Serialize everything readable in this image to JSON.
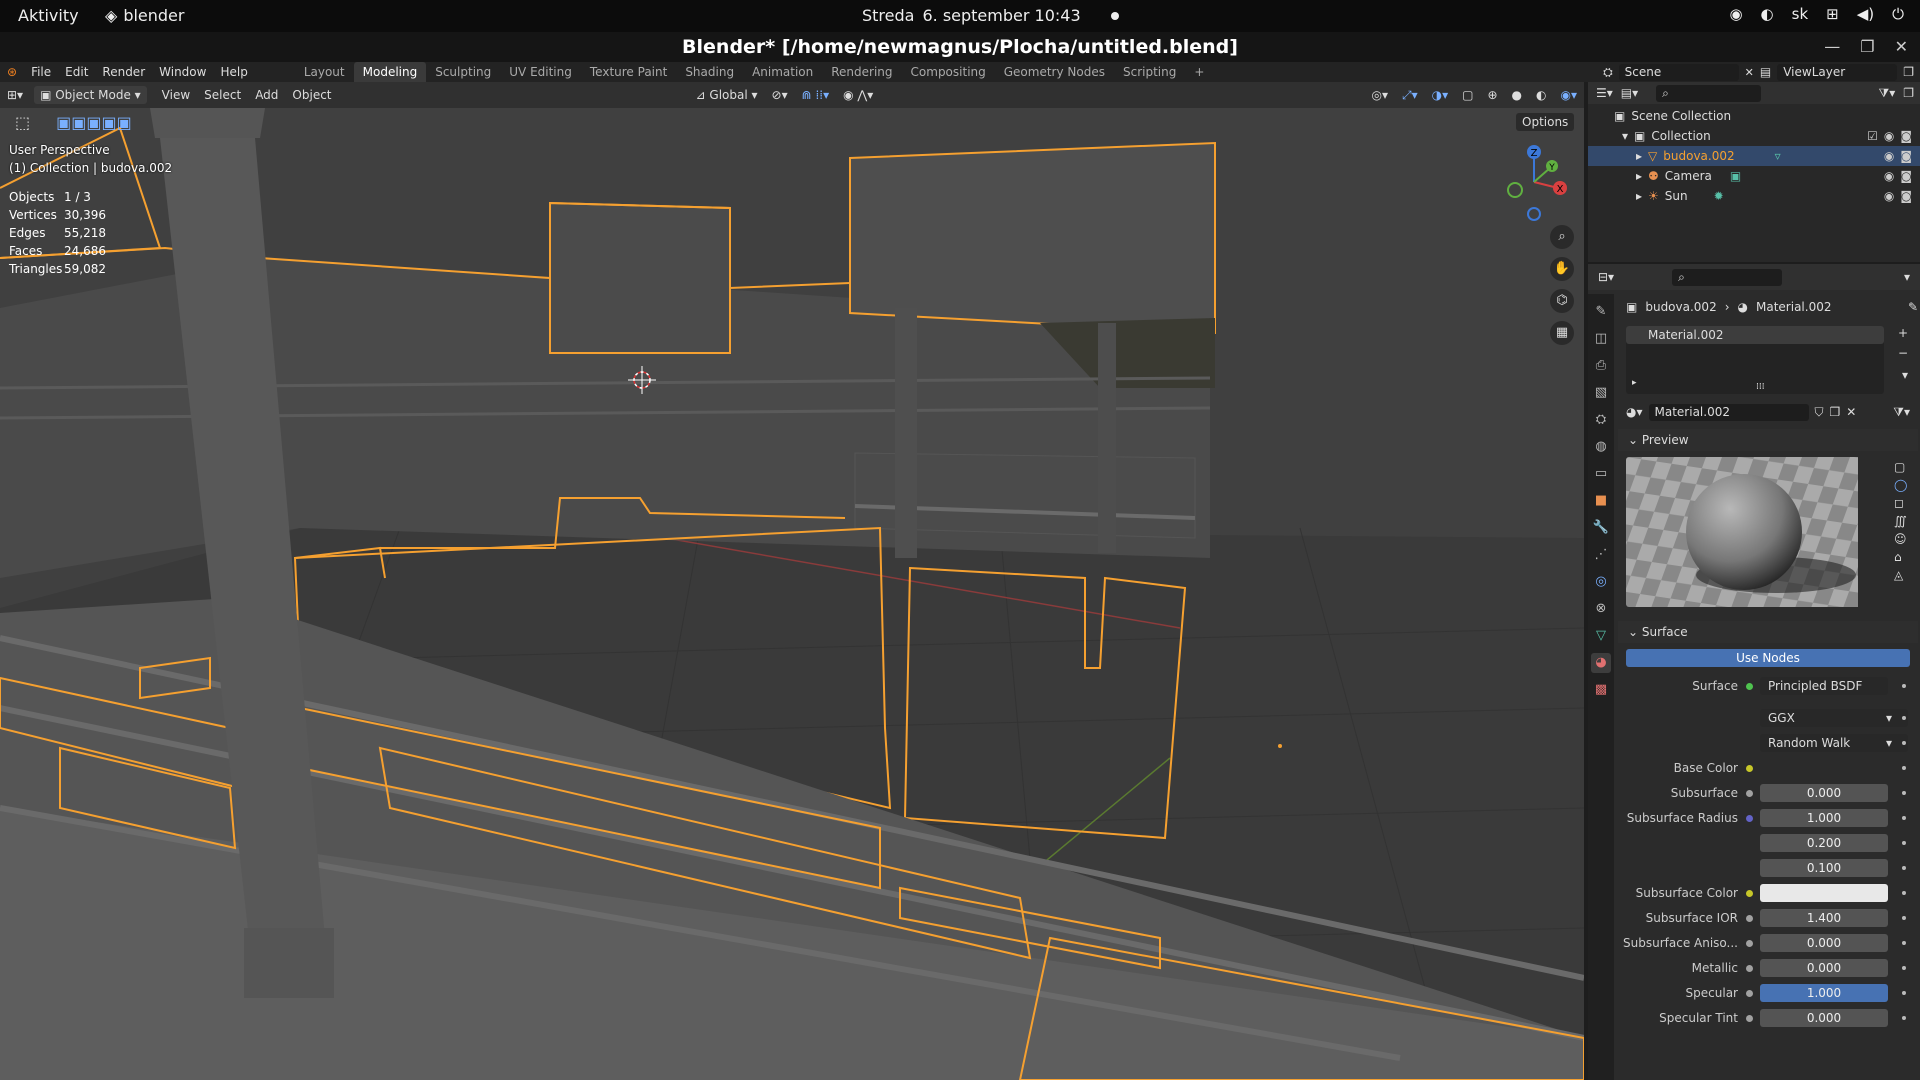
{
  "system_bar": {
    "activities": "Aktivity",
    "app_name": "blender",
    "day": "Streda",
    "date_time": "6. september  10:43",
    "keyboard": "sk"
  },
  "window": {
    "title": "Blender* [/home/newmagnus/Plocha/untitled.blend]"
  },
  "menus": [
    "File",
    "Edit",
    "Render",
    "Window",
    "Help"
  ],
  "workspaces": [
    "Layout",
    "Modeling",
    "Sculpting",
    "UV Editing",
    "Texture Paint",
    "Shading",
    "Animation",
    "Rendering",
    "Compositing",
    "Geometry Nodes",
    "Scripting"
  ],
  "active_workspace": "Modeling",
  "scene": {
    "name": "Scene",
    "view_layer": "ViewLayer"
  },
  "viewport_header": {
    "mode": "Object Mode",
    "menus": [
      "View",
      "Select",
      "Add",
      "Object"
    ],
    "transform": "Global",
    "options": "Options"
  },
  "viewport_overlay": {
    "perspective": "User Perspective",
    "collection_info": "(1) Collection | budova.002"
  },
  "stats": [
    {
      "k": "Objects",
      "v": "1 / 3"
    },
    {
      "k": "Vertices",
      "v": "30,396"
    },
    {
      "k": "Edges",
      "v": "55,218"
    },
    {
      "k": "Faces",
      "v": "24,686"
    },
    {
      "k": "Triangles",
      "v": "59,082"
    }
  ],
  "gizmo": {
    "x": "X",
    "y": "Y",
    "z": "Z"
  },
  "outliner": {
    "root": "Scene Collection",
    "collection": "Collection",
    "items": [
      "budova.002",
      "Camera",
      "Sun"
    ]
  },
  "properties": {
    "object": "budova.002",
    "material": "Material.002",
    "slot": "Material.002",
    "datablock": "Material.002",
    "preview_label": "Preview",
    "surface_label": "Surface",
    "use_nodes": "Use Nodes",
    "rows": [
      {
        "label": "Surface",
        "value": "Principled BSDF",
        "kind": "shader",
        "sock": "#4fc34f"
      },
      {
        "label": "",
        "value": "GGX",
        "kind": "dropdown"
      },
      {
        "label": "",
        "value": "Random Walk",
        "kind": "dropdown"
      },
      {
        "label": "Base Color",
        "value": "",
        "kind": "color-empty",
        "sock": "#c7c729"
      },
      {
        "label": "Subsurface",
        "value": "0.000",
        "kind": "num",
        "sock": "#a1a1a1"
      },
      {
        "label": "Subsurface Radius",
        "value": "1.000",
        "kind": "num",
        "sock": "#6363c7"
      },
      {
        "label": "",
        "value": "0.200",
        "kind": "num"
      },
      {
        "label": "",
        "value": "0.100",
        "kind": "num"
      },
      {
        "label": "Subsurface Color",
        "value": "",
        "kind": "white",
        "sock": "#c7c729"
      },
      {
        "label": "Subsurface IOR",
        "value": "1.400",
        "kind": "num",
        "sock": "#a1a1a1"
      },
      {
        "label": "Subsurface Aniso...",
        "value": "0.000",
        "kind": "num",
        "sock": "#a1a1a1"
      },
      {
        "label": "Metallic",
        "value": "0.000",
        "kind": "num",
        "sock": "#a1a1a1"
      },
      {
        "label": "Specular",
        "value": "1.000",
        "kind": "blue",
        "sock": "#a1a1a1"
      },
      {
        "label": "Specular Tint",
        "value": "0.000",
        "kind": "num",
        "sock": "#a1a1a1"
      }
    ]
  },
  "colors": {
    "selection_outline": "#f5a030",
    "accent_blue": "#4772b3",
    "viewport_bg": "#3f3f3f"
  }
}
